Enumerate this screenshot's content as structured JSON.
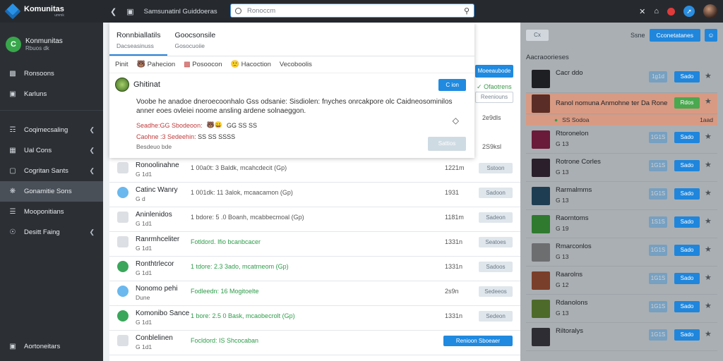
{
  "app": {
    "title": "Komunitas",
    "subtitle": "ummk"
  },
  "topbar": {
    "breadcrumb": "Samsunatinl Guiddoeras",
    "search_placeholder": "Ronoccm",
    "icons": [
      "back-icon",
      "page-icon",
      "close-x-icon",
      "home-icon",
      "notification-icon",
      "compass-icon"
    ]
  },
  "sidebar": {
    "community_name": "Konmunitas",
    "community_sub": "Rbuos dk",
    "community_initial": "C",
    "items": [
      {
        "label": "Ronsoons",
        "icon": "users-icon"
      },
      {
        "label": "Karluns",
        "icon": "chat-icon"
      },
      {
        "label": "Coqimecsaling",
        "icon": "book-icon",
        "chevron": true
      },
      {
        "label": "Ual Cons",
        "icon": "calendar-icon",
        "chevron": true
      },
      {
        "label": "Cogritan Sants",
        "icon": "settings-icon",
        "chevron": true
      },
      {
        "label": "Gonamitie Sons",
        "icon": "gear-icon",
        "active": true
      },
      {
        "label": "Mooponitians",
        "icon": "list-icon"
      },
      {
        "label": "Desitt Faing",
        "icon": "globe-icon",
        "chevron": true
      }
    ],
    "footer": {
      "label": "Aortoneitars",
      "icon": "person-icon"
    }
  },
  "tabs": [
    {
      "label": "Ronnbiallatils",
      "sub": "Dacseasinuss"
    },
    {
      "label": "Goocsonsile",
      "sub": "Gosocuoiie"
    }
  ],
  "filter": {
    "label": "Pinit",
    "items": [
      "Pahecion",
      "Posoocon",
      "Hacoction",
      "Vecoboolis"
    ]
  },
  "post": {
    "title": "Ghitinat",
    "button": "C ion",
    "body": "Voobe he anadoe dneroecoonhalo Gss odsanie: Sisdiolen: fnyches onrcakpore olc Caidneosominilos anner eoes ovleiei noome ansling ardene solnaeggon.",
    "meta_red": "Seadhe:GG Sbodeoon:",
    "meta_icons": "GG SS SS",
    "meta_line2": "Caohne :3 Sedeehin:",
    "meta_line2_tail": "SS SS SSSS",
    "meta_line3": "Besdeuo bde",
    "reply_button": "Sattios"
  },
  "right_column": {
    "cta": "Moeeaubode",
    "check": "Ofaotrens",
    "outline_btn": "Reeniouns",
    "num1": "2e9dls",
    "num2": "2S9ksl"
  },
  "rows": [
    {
      "title": "Ronoolinahne",
      "sub": "G 1d1",
      "mid": "1 00a0t: 3 Baldk, mcahcdecit (Gp)",
      "num": "1221m",
      "btn": "Sstoon",
      "icon": "sq",
      "mid_color": ""
    },
    {
      "title": "Catinc Wanry",
      "sub": "G d",
      "mid": "1 001dk: 11 3alok, mcaacamon (Gp)",
      "num": "1931",
      "btn": "Sadoon",
      "icon": "circle",
      "mid_color": ""
    },
    {
      "title": "Aninlenidos",
      "sub": "G 1d1",
      "mid": "1 bdore: 5 .0 Boanh, mcabbecmoal (Gp)",
      "num": "1181m",
      "btn": "Sadeon",
      "icon": "sq",
      "mid_color": ""
    },
    {
      "title": "Ranrmhceliter",
      "sub": "G 1d1",
      "mid": "Fotldord.  Ifio bcanbcacer",
      "num": "1331n",
      "btn": "Seatoes",
      "icon": "sq",
      "mid_color": "green"
    },
    {
      "title": "Ronthtrlecor",
      "sub": "G 1d1",
      "mid": "1 tdore: 2.3 3ado, mcatrneom (Gp)",
      "num": "1331n",
      "btn": "Sadoos",
      "icon": "gr",
      "mid_color": "green"
    },
    {
      "title": "Nonomo pehi",
      "sub": "Dune",
      "mid": "Fodleedn:  16  Mogitoelte",
      "num": "2s9n",
      "btn": "Sedeeos",
      "icon": "circle",
      "mid_color": "green"
    },
    {
      "title": "Komonibo Sance",
      "sub": "G 1d1",
      "mid": "1 bore: 2.5 0 Bask, mcaobecrolt (Gp)",
      "num": "1331n",
      "btn": "Sedeon",
      "icon": "gr",
      "mid_color": "green"
    },
    {
      "title": "Conblelinen",
      "sub": "G 1d1",
      "mid": "Focldord:  IS  Shcocaban",
      "num": "",
      "btn": "Renioon Sboeaer",
      "icon": "sq",
      "mid_color": "green",
      "btn_blue": true
    }
  ],
  "right_panel": {
    "chip": "Cx",
    "label": "Ssne",
    "primary_button": "Cconetatanes",
    "header": "Aacraoorieses",
    "items": [
      {
        "title": "Cacr ddo",
        "sub": "",
        "ghost": "1g1d",
        "btn": "Sado",
        "thumb": "#1e1f23"
      },
      {
        "title": "Ranol nomuna Anmohne ter Da Rone",
        "sub": "",
        "ghost": "",
        "btn": "Rdos",
        "thumb": "#5a2e26",
        "highlight": true,
        "green": true
      },
      {
        "title": "Rtoronelon",
        "sub": "G 13",
        "ghost": "1G1S",
        "btn": "Sado",
        "thumb": "#6a1b3a"
      },
      {
        "title": "Rotrone Corles",
        "sub": "G 13",
        "ghost": "1G1S",
        "btn": "Sado",
        "thumb": "#2a1f2b"
      },
      {
        "title": "Rarmalmms",
        "sub": "G 13",
        "ghost": "1G1S",
        "btn": "Sado",
        "thumb": "#1f3d52"
      },
      {
        "title": "Raorntoms",
        "sub": "G 19",
        "ghost": "1S1S",
        "btn": "Sado",
        "thumb": "#2f7a2f"
      },
      {
        "title": "Rmarconlos",
        "sub": "G 13",
        "ghost": "1G1S",
        "btn": "Sado",
        "thumb": "#6d6e70"
      },
      {
        "title": "Raarolns",
        "sub": "G 12",
        "ghost": "1G1S",
        "btn": "Sado",
        "thumb": "#7a3f2a"
      },
      {
        "title": "Rdanolons",
        "sub": "G 13",
        "ghost": "1G1S",
        "btn": "Sado",
        "thumb": "#4e6a2a"
      },
      {
        "title": "Riltoralys",
        "sub": "",
        "ghost": "1G1S",
        "btn": "Sado",
        "thumb": "#2d2d33"
      }
    ],
    "under_highlight_left": "SS Sodoa",
    "under_highlight_right": "1aad",
    "lock_icon": "lock-icon"
  },
  "colors": {
    "accent": "#1f86dc",
    "sidebar": "#2c3035",
    "topbar": "#262a2f",
    "highlight": "#d89a83"
  }
}
